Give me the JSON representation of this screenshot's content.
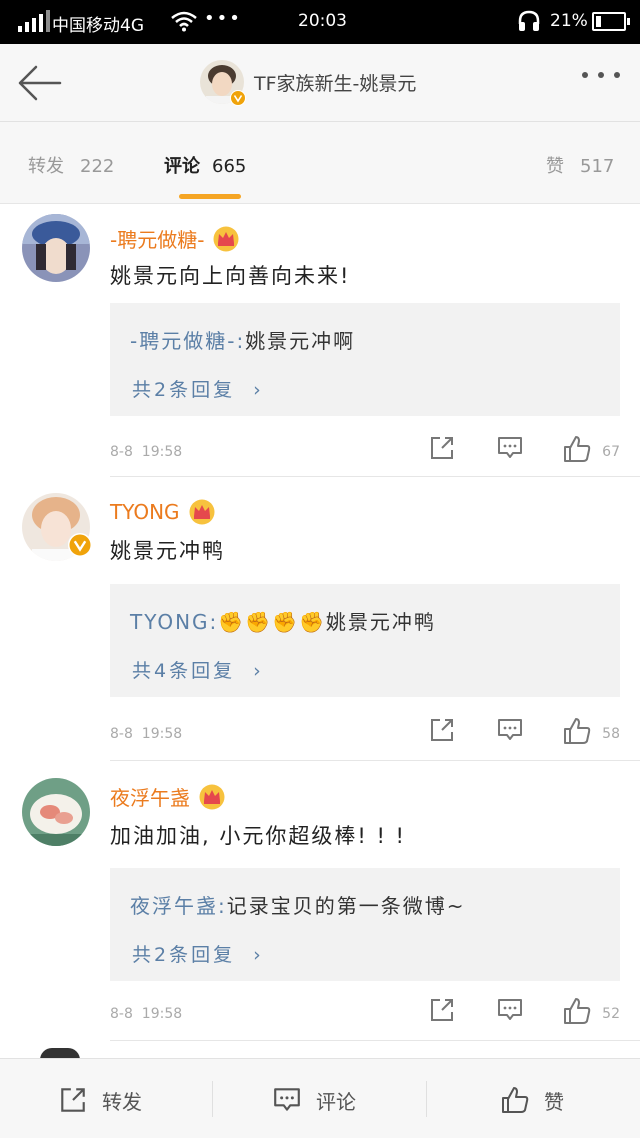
{
  "status_bar": {
    "carrier": "中国移动4G",
    "more": "•••",
    "time": "20:03",
    "battery_pct": "21%",
    "battery_level": 0.21
  },
  "header": {
    "title": "TF家族新生-姚景元"
  },
  "tabs": [
    {
      "label": "转发",
      "count": "222"
    },
    {
      "label": "评论",
      "count": "665"
    },
    {
      "label": "赞",
      "count": "517"
    }
  ],
  "comments": [
    {
      "user": "-聘元做糖-",
      "text": "姚景元向上向善向未来!",
      "reply_user": "-聘元做糖-",
      "reply_sep": ":",
      "reply_text": "姚景元冲啊",
      "reply_more": "共2条回复",
      "date": "8-8",
      "time": "19:58",
      "likes": "67"
    },
    {
      "user": "TYONG",
      "text": "姚景元冲鸭",
      "reply_user": "TYONG",
      "reply_sep": ":",
      "reply_text": "✊✊✊✊姚景元冲鸭",
      "reply_more": "共4条回复",
      "date": "8-8",
      "time": "19:58",
      "likes": "58"
    },
    {
      "user": "夜浮午盏",
      "text": "加油加油, 小元你超级棒! ! !",
      "reply_user": "夜浮午盏",
      "reply_sep": ":",
      "reply_text": "记录宝贝的第一条微博~",
      "reply_more": "共2条回复",
      "date": "8-8",
      "time": "19:58",
      "likes": "52"
    }
  ],
  "bottom_bar": {
    "repost": "转发",
    "comment": "评论",
    "like": "赞"
  },
  "colors": {
    "accent": "#f5a524",
    "username": "#eb7b1e",
    "link": "#5b7fa6",
    "verified": "#f0a30a"
  }
}
